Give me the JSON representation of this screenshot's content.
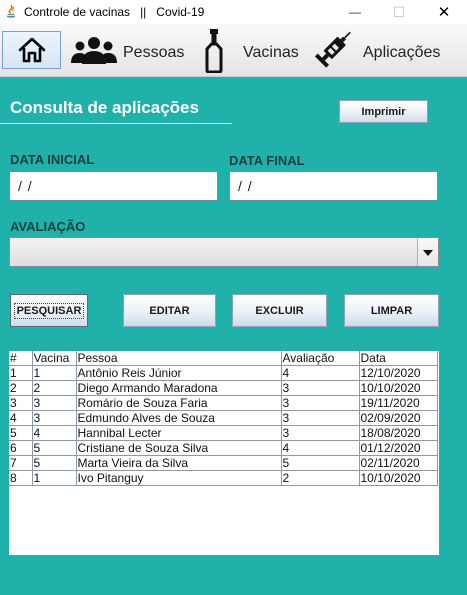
{
  "window": {
    "title": "Controle de vacinas   ||   Covid-19",
    "minimize_symbol": "—",
    "maximize_symbol": "☐",
    "close_symbol": "✕"
  },
  "toolbar": {
    "home_icon": "home-icon",
    "pessoas": "Pessoas",
    "vacinas": "Vacinas",
    "aplicacoes": "Aplicações"
  },
  "page": {
    "heading": "Consulta de aplicações",
    "print_button": "Imprimir"
  },
  "filters": {
    "data_inicial_label": "DATA INICIAL",
    "data_inicial_value": " / /",
    "data_final_label": "DATA FINAL",
    "data_final_value": " / /",
    "avaliacao_label": "AVALIAÇÃO",
    "avaliacao_value": ""
  },
  "actions": {
    "pesquisar": "PESQUISAR",
    "editar": "EDITAR",
    "excluir": "EXCLUIR",
    "limpar": "LIMPAR"
  },
  "table": {
    "columns": [
      "#",
      "Vacina",
      "Pessoa",
      "Avaliação",
      "Data"
    ],
    "rows": [
      [
        "1",
        "1",
        "Antônio Reis Júnior",
        "4",
        "12/10/2020"
      ],
      [
        "2",
        "2",
        "Diego Armando Maradona",
        "3",
        "10/10/2020"
      ],
      [
        "3",
        "3",
        "Romário de Souza Faria",
        "3",
        "19/11/2020"
      ],
      [
        "4",
        "3",
        "Edmundo Alves de Souza",
        "3",
        "02/09/2020"
      ],
      [
        "5",
        "4",
        "Hannibal Lecter",
        "3",
        "18/08/2020"
      ],
      [
        "6",
        "5",
        "Cristiane de Souza Silva",
        "4",
        "01/12/2020"
      ],
      [
        "7",
        "5",
        "Marta Vieira da Silva",
        "5",
        "02/11/2020"
      ],
      [
        "8",
        "1",
        "Ivo Pitanguy",
        "2",
        "10/10/2020"
      ]
    ]
  },
  "colors": {
    "background": "#20b2aa",
    "heading_text": "#ffffff"
  }
}
